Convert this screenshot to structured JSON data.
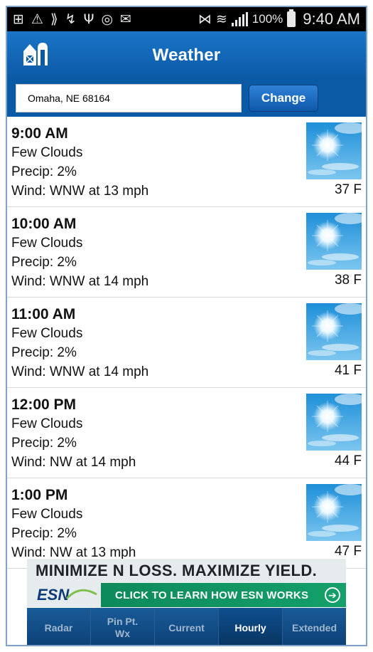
{
  "status_bar": {
    "icons": [
      "add-box-icon",
      "warning-icon",
      "sprint-icon",
      "missed-call-icon",
      "usb-icon",
      "voicemail-icon",
      "email-icon",
      "vibrate-icon",
      "wifi-icon",
      "signal-icon"
    ],
    "battery_percent": "100%",
    "time": "9:40 AM"
  },
  "header": {
    "title": "Weather",
    "logo_icon": "barn-icon"
  },
  "location": {
    "value": "Omaha, NE 68164",
    "change_label": "Change"
  },
  "forecast": [
    {
      "time": "9:00 AM",
      "condition": "Few Clouds",
      "precip": "Precip: 2%",
      "wind": "Wind: WNW at 13 mph",
      "temp": "37 F"
    },
    {
      "time": "10:00 AM",
      "condition": "Few Clouds",
      "precip": "Precip: 2%",
      "wind": "Wind: WNW at 14 mph",
      "temp": "38 F"
    },
    {
      "time": "11:00 AM",
      "condition": "Few Clouds",
      "precip": "Precip: 2%",
      "wind": "Wind: WNW at 14 mph",
      "temp": "41 F"
    },
    {
      "time": "12:00 PM",
      "condition": "Few Clouds",
      "precip": "Precip: 2%",
      "wind": "Wind: NW at 14 mph",
      "temp": "44 F"
    },
    {
      "time": "1:00 PM",
      "condition": "Few Clouds",
      "precip": "Precip: 2%",
      "wind": "Wind: NW at 13 mph",
      "temp": "47 F"
    }
  ],
  "ad": {
    "headline": "MINIMIZE N LOSS. MAXIMIZE YIELD.",
    "brand": "ESN",
    "cta": "CLICK TO LEARN HOW ESN WORKS"
  },
  "tabs": [
    {
      "label": "Radar",
      "active": false
    },
    {
      "label": "Pin Pt.\nWx",
      "active": false
    },
    {
      "label": "Current",
      "active": false
    },
    {
      "label": "Hourly",
      "active": true
    },
    {
      "label": "Extended",
      "active": false
    }
  ],
  "colors": {
    "header_blue": "#0b5aa6",
    "tab_bar": "#0b3f73",
    "ad_green": "#14a06a"
  }
}
